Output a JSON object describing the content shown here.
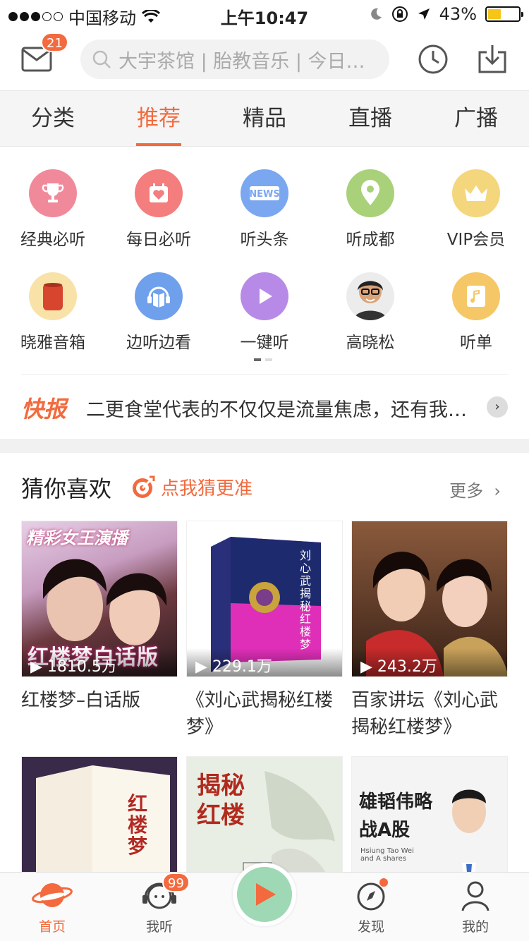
{
  "status_bar": {
    "carrier": "中国移动",
    "time": "上午10:47",
    "battery": "43%"
  },
  "header": {
    "mail_badge": "21",
    "search_placeholder": "大宇茶馆 | 胎教音乐 | 今日…"
  },
  "tabs": [
    {
      "label": "分类",
      "active": false
    },
    {
      "label": "推荐",
      "active": true
    },
    {
      "label": "精品",
      "active": false
    },
    {
      "label": "直播",
      "active": false
    },
    {
      "label": "广播",
      "active": false
    }
  ],
  "grid": [
    {
      "label": "经典必听",
      "icon": "trophy-icon",
      "color": "#f08a9b"
    },
    {
      "label": "每日必听",
      "icon": "calendar-heart-icon",
      "color": "#f47d7d"
    },
    {
      "label": "听头条",
      "icon": "news-icon",
      "color": "#7aa7f0"
    },
    {
      "label": "听成都",
      "icon": "location-pin-icon",
      "color": "#a8d17a"
    },
    {
      "label": "VIP会员",
      "icon": "crown-icon",
      "color": "#f4d77c"
    },
    {
      "label": "晓雅音箱",
      "icon": "speaker-icon",
      "color": "#f9e2a8"
    },
    {
      "label": "边听边看",
      "icon": "headphones-book-icon",
      "color": "#6ea0ec"
    },
    {
      "label": "一键听",
      "icon": "play-icon",
      "color": "#b88ae8"
    },
    {
      "label": "高晓松",
      "icon": "avatar-icon",
      "color": "#c8c8c8"
    },
    {
      "label": "听单",
      "icon": "playlist-icon",
      "color": "#f6c766"
    }
  ],
  "news": {
    "tag": "快报",
    "text": "二更食堂代表的不仅仅是流量焦虑，还有我…"
  },
  "guess": {
    "title": "猜你喜欢",
    "refine": "点我猜更准",
    "more": "更多"
  },
  "cards": [
    {
      "title": "红楼梦–白话版",
      "plays": "1810.5万",
      "cover_text": "红楼梦白话版",
      "banner": "精彩女王演播"
    },
    {
      "title": "《刘心武揭秘红楼梦》",
      "plays": "229.1万",
      "cover_text": "刘心武揭秘红楼梦"
    },
    {
      "title": "百家讲坛《刘心武揭秘红楼梦》",
      "plays": "243.2万"
    },
    {
      "title": "",
      "plays": "",
      "cover_text": "红楼梦"
    },
    {
      "title": "",
      "plays": "",
      "cover_text": "揭秘红楼"
    },
    {
      "title": "",
      "plays": "",
      "cover_text": "雄韬伟略 战A股",
      "sub": "Hsiung Tao Wei and A shares"
    }
  ],
  "bottom_nav": {
    "home": "首页",
    "listen": "我听",
    "listen_badge": "99",
    "discover": "发现",
    "mine": "我的"
  }
}
